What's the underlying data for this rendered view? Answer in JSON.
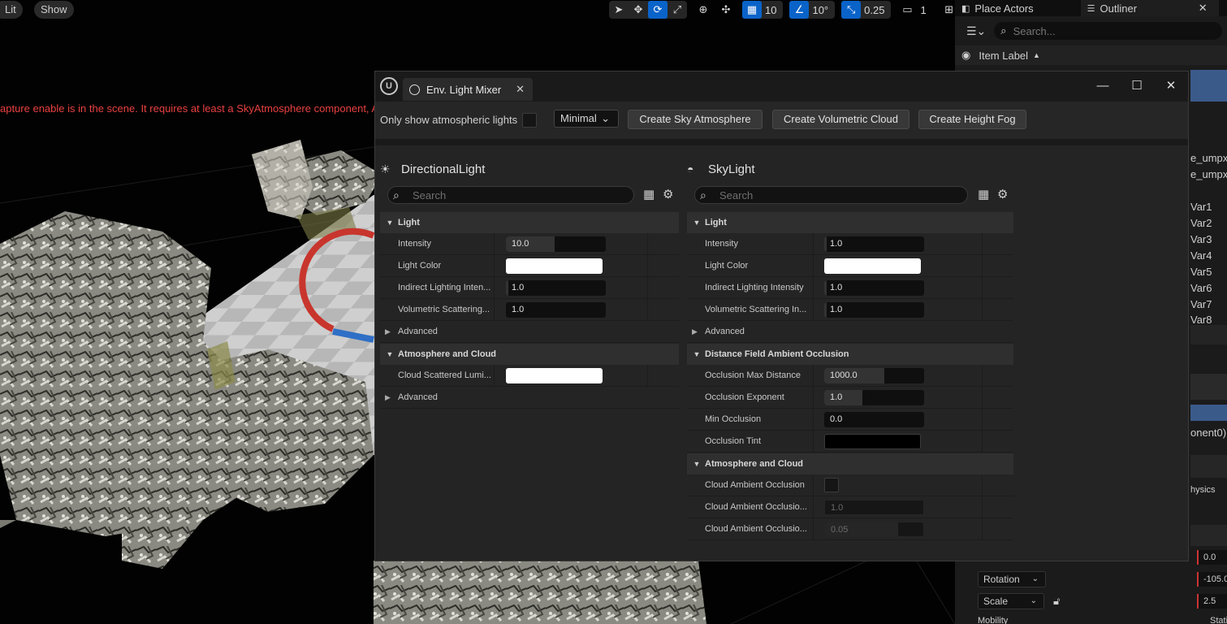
{
  "viewport": {
    "view_mode": "Lit",
    "show_label": "Show",
    "grid_snap": "10",
    "rotation_snap": "10°",
    "scale_snap": "0.25",
    "camera_speed": "1",
    "warning": "apture enable is in the scene. It requires at least a SkyAtmosphere component, A"
  },
  "outliner": {
    "place_actors_tab": "Place Actors",
    "outliner_tab": "Outliner",
    "close": "✕",
    "search_placeholder": "Search...",
    "column_item_label": "Item Label",
    "items": [
      "e_umpx",
      "e_umpx",
      "Var1",
      "Var2",
      "Var3",
      "Var4",
      "Var5",
      "Var6",
      "Var7",
      "Var8"
    ],
    "component_text": "onent0)",
    "physics_text": "hysics",
    "location_value": "0.0",
    "rotation_label": "Rotation",
    "rotation_value": "-105.0",
    "scale_label": "Scale",
    "scale_value": "2.5",
    "mobility_label": "Mobility",
    "mobility_value": "Stati"
  },
  "mixer": {
    "tab_title": "Env. Light Mixer",
    "tab_close": "✕",
    "only_atmospheric_label": "Only show atmospheric lights",
    "only_atmospheric_checked": false,
    "view_mode": "Minimal",
    "buttons": {
      "sky_atmosphere": "Create Sky Atmosphere",
      "volumetric_cloud": "Create Volumetric Cloud",
      "height_fog": "Create Height Fog"
    },
    "directional": {
      "title": "DirectionalLight",
      "search_placeholder": "Search",
      "light_category": "Light",
      "intensity_label": "Intensity",
      "intensity_value": "10.0",
      "intensity_fill": 0.5,
      "light_color_label": "Light Color",
      "light_color": "#ffffff",
      "indirect_label": "Indirect Lighting Inten...",
      "indirect_value": "1.0",
      "volumetric_label": "Volumetric Scattering...",
      "volumetric_value": "1.0",
      "advanced_label": "Advanced",
      "atmo_category": "Atmosphere and Cloud",
      "cloud_lum_label": "Cloud Scattered Lumi...",
      "cloud_lum_color": "#ffffff",
      "advanced2_label": "Advanced"
    },
    "skylight": {
      "title": "SkyLight",
      "search_placeholder": "Search",
      "light_category": "Light",
      "intensity_label": "Intensity",
      "intensity_value": "1.0",
      "light_color_label": "Light Color",
      "light_color": "#ffffff",
      "indirect_label": "Indirect Lighting Intensity",
      "indirect_value": "1.0",
      "volumetric_label": "Volumetric Scattering In...",
      "volumetric_value": "1.0",
      "advanced_label": "Advanced",
      "dfao_category": "Distance Field Ambient Occlusion",
      "occ_max_label": "Occlusion Max Distance",
      "occ_max_value": "1000.0",
      "occ_max_fill": 0.6,
      "occ_exp_label": "Occlusion Exponent",
      "occ_exp_value": "1.0",
      "occ_exp_fill": 0.38,
      "min_occ_label": "Min Occlusion",
      "min_occ_value": "0.0",
      "occ_tint_label": "Occlusion Tint",
      "occ_tint_color": "#000000",
      "atmo_category": "Atmosphere and Cloud",
      "cloud_ao_label": "Cloud Ambient Occlusion",
      "cloud_ao_checked": false,
      "cloud_ao_strength_label": "Cloud Ambient Occlusio...",
      "cloud_ao_strength_value": "1.0",
      "cloud_ao_extent_label": "Cloud Ambient Occlusio...",
      "cloud_ao_extent_value": "0.05",
      "cloud_ao_extent_fill": 0.75
    }
  }
}
